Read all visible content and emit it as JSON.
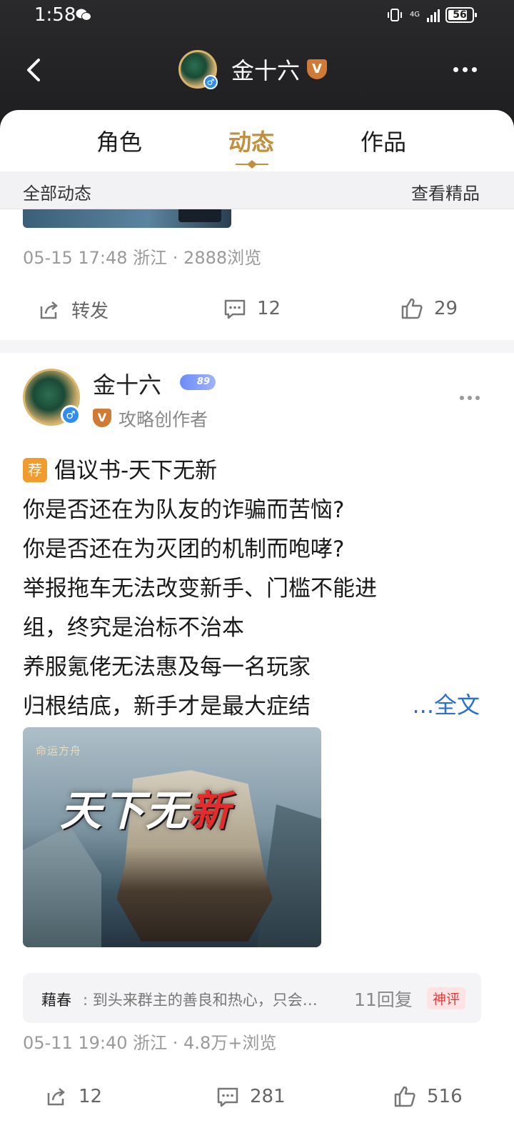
{
  "status_bar": {
    "time": "1:58",
    "network": "4G",
    "battery": "56"
  },
  "header": {
    "title": "金十六"
  },
  "tabs": [
    {
      "label": "角色"
    },
    {
      "label": "动态"
    },
    {
      "label": "作品"
    }
  ],
  "filter": {
    "left": "全部动态",
    "right": "查看精品"
  },
  "post1": {
    "meta": "05-15 17:48 浙江 · 2888浏览",
    "share_label": "转发",
    "comment_count": "12",
    "like_count": "29"
  },
  "post2": {
    "author": "金十六",
    "level": "89",
    "role": "攻略创作者",
    "tag": "荐",
    "title": "倡议书-天下无新",
    "lines": [
      "你是否还在为队友的诈骗而苦恼?",
      "你是否还在为灭团的机制而咆哮?",
      "举报拖车无法改变新手、门槛不能进",
      "组，终究是治标不治本",
      "养服氪佬无法惠及每一名玩家",
      "归根结底，新手才是最大症结"
    ],
    "full_text": "...全文",
    "image": {
      "logo": "命运方舟",
      "title_main": "天下无",
      "title_red": "新"
    },
    "hot_comment": {
      "user": "藉春",
      "text": ": 到头来群主的善良和热心，只会…",
      "replies": "11回复",
      "badge": "神评"
    },
    "meta": "05-11 19:40 浙江 · 4.8万+浏览",
    "share_count": "12",
    "comment_count": "281",
    "like_count": "516"
  },
  "colors": {
    "accent": "#c0903f",
    "link": "#2a6fd6",
    "badge_orange": "#d07a35"
  }
}
